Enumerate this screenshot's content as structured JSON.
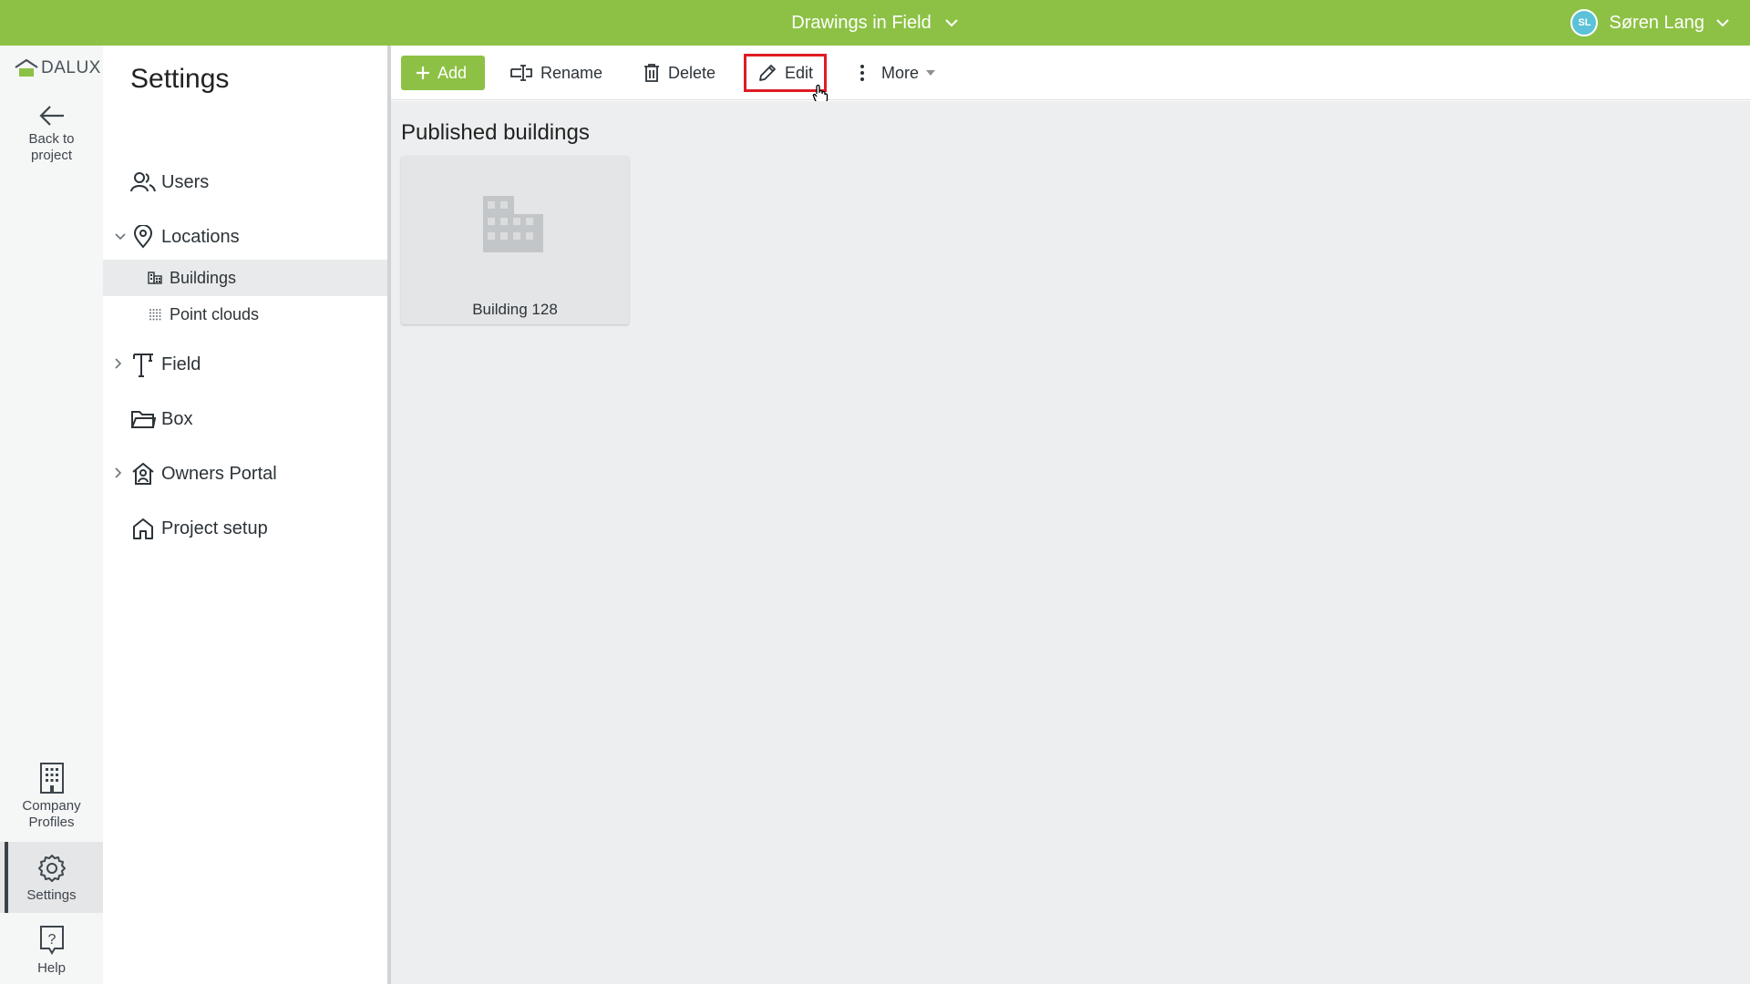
{
  "topbar": {
    "title": "Drawings in Field",
    "user_initials": "SL",
    "user_name": "Søren Lang",
    "color": "#8dc145"
  },
  "rail": {
    "logo_text": "DALUX",
    "back_label_line1": "Back to",
    "back_label_line2": "project",
    "company_label_line1": "Company",
    "company_label_line2": "Profiles",
    "settings_label": "Settings",
    "help_label": "Help"
  },
  "sidebar": {
    "heading": "Settings",
    "items": [
      {
        "label": "Users",
        "icon": "users-icon"
      },
      {
        "label": "Locations",
        "icon": "location-pin-icon",
        "expanded": true
      },
      {
        "label": "Buildings",
        "icon": "building-icon",
        "selected": true
      },
      {
        "label": "Point clouds",
        "icon": "point-cloud-icon"
      },
      {
        "label": "Field",
        "icon": "crane-icon",
        "expandable": true
      },
      {
        "label": "Box",
        "icon": "folder-open-icon"
      },
      {
        "label": "Owners Portal",
        "icon": "house-person-icon",
        "expandable": true
      },
      {
        "label": "Project setup",
        "icon": "house-icon"
      }
    ]
  },
  "toolbar": {
    "add_label": "Add",
    "rename_label": "Rename",
    "delete_label": "Delete",
    "edit_label": "Edit",
    "more_label": "More"
  },
  "content": {
    "section_title": "Published buildings",
    "cards": [
      {
        "name": "Building 128"
      }
    ]
  }
}
